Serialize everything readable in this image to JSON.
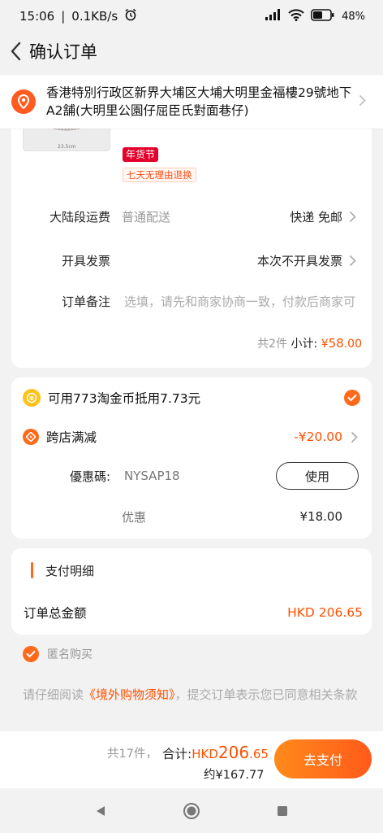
{
  "status_bar": {
    "time": "15:06",
    "net_speed": "0.1KB/s",
    "battery": "48"
  },
  "header": {
    "title": "确认订单"
  },
  "address": {
    "text": "香港特別行政区新界大埔区大埔大明里金福樓29號地下A2舗(大明里公園仔屈臣氏對面巷仔)"
  },
  "product": {
    "image_ruler": "23.5cm",
    "badge_festival": "年货节",
    "badge_return": "七天无理由退换"
  },
  "rows": {
    "shipping": {
      "label": "大陆段运费",
      "muted": "普通配送",
      "value": "快递 免邮"
    },
    "invoice": {
      "label": "开具发票",
      "value": "本次不开具发票"
    },
    "remark": {
      "label": "订单备注",
      "placeholder": "选填，请先和商家协商一致，付款后商家可"
    }
  },
  "subtotal": {
    "count": "共2件",
    "label": "小计:",
    "currency": "¥",
    "integer": "58",
    "decimal": ".00"
  },
  "discounts": {
    "coin_text": "可用773淘金币抵用7.73元",
    "cross_store_label": "跨店满减",
    "cross_store_amount": "-¥20.00",
    "coupon_label": "優惠碼:",
    "coupon_code": "NYSAP18",
    "use_button": "使用",
    "discount_label": "优惠",
    "discount_value": "¥18.00"
  },
  "payment": {
    "title": "支付明细",
    "total_label": "订单总金额",
    "total_value": "HKD 206.65"
  },
  "anonymous": {
    "label": "匿名购买"
  },
  "notice": {
    "prefix": "请仔细阅读",
    "link": "《境外购物须知》",
    "suffix": "，提交订单表示您已同意相关条款"
  },
  "bottom": {
    "count": "共17件，",
    "label": "合计:",
    "currency": "HKD",
    "integer": "206",
    "decimal": ".65",
    "approx": "约¥167.77",
    "pay_button": "去支付"
  },
  "colors": {
    "accent": "#ff5000",
    "pin": "#ff5a1f",
    "badge_red": "#e4002b",
    "coin": "#ffc21a"
  }
}
